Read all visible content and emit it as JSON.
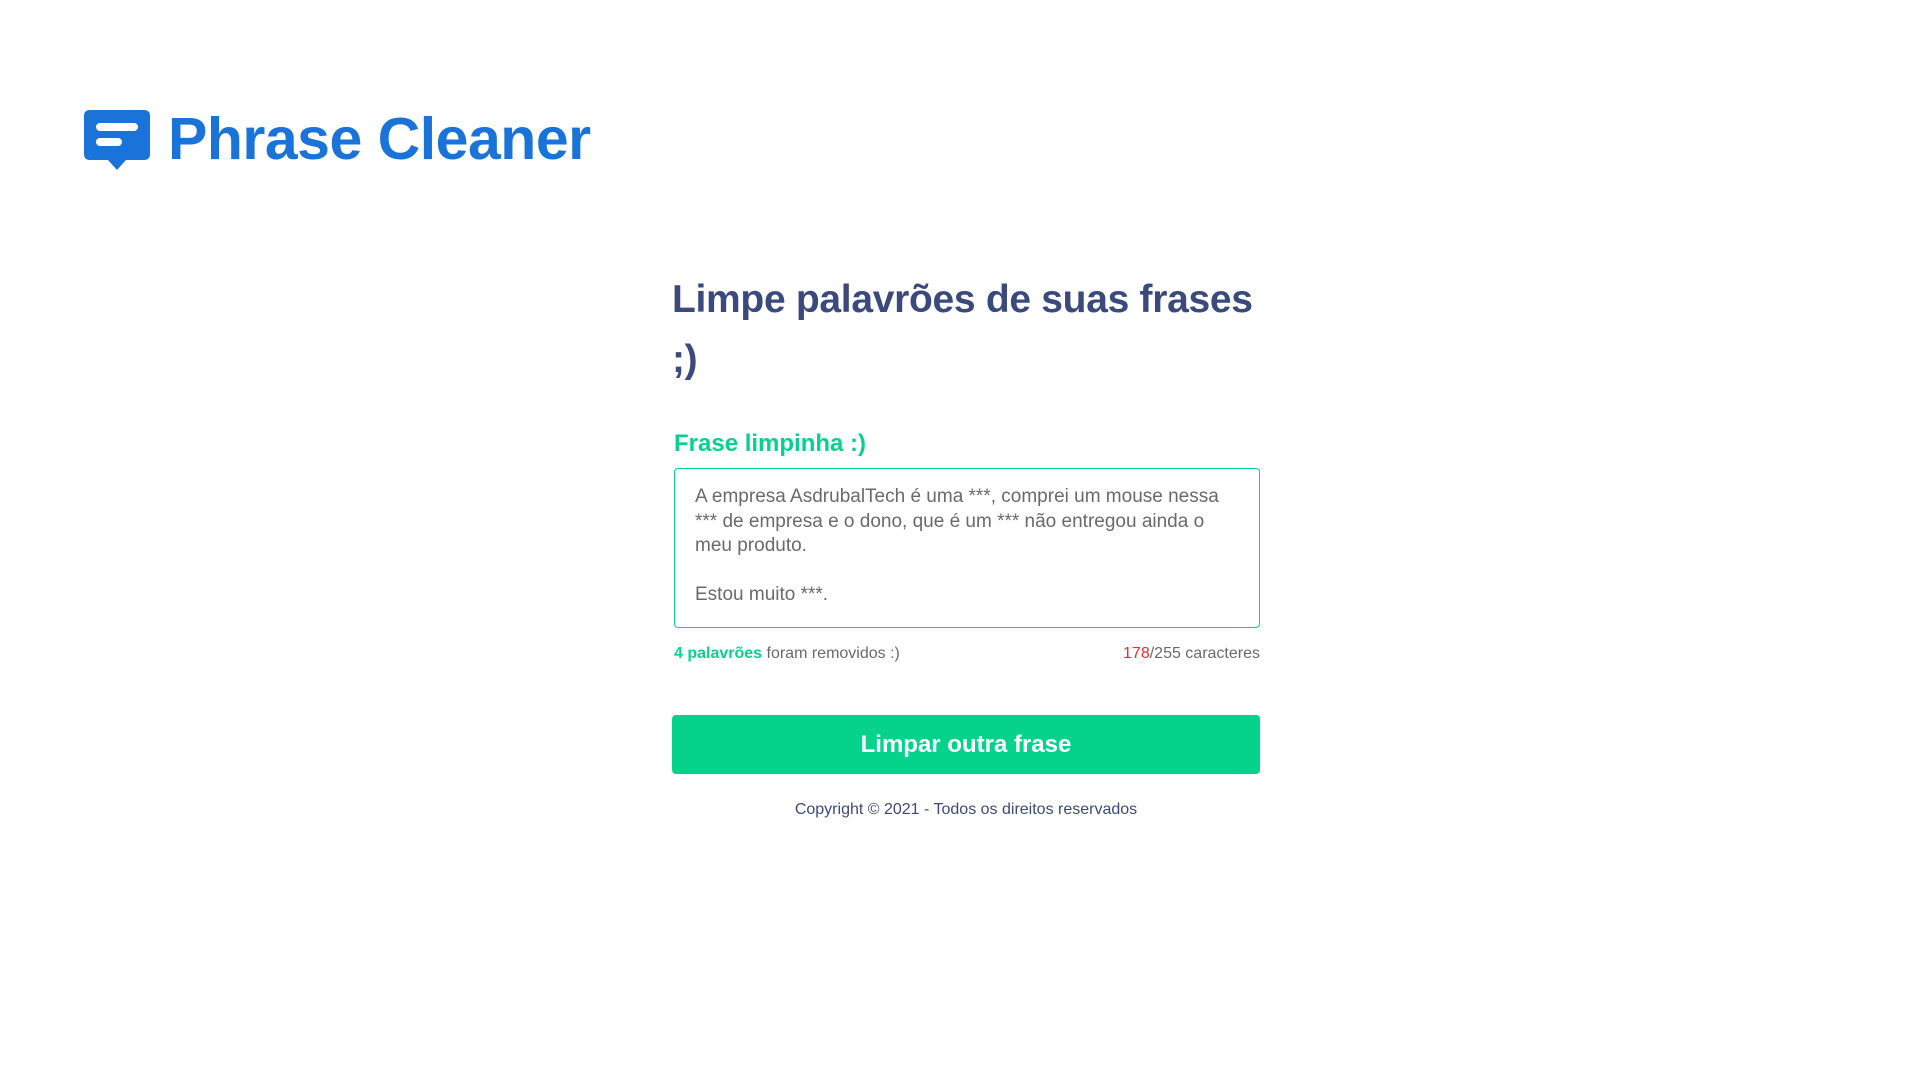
{
  "header": {
    "logo_icon": "chat-message-icon",
    "brand_name": "Phrase Cleaner",
    "brand_color": "#1a73d9"
  },
  "main": {
    "headline": "Limpe palavrões de suas frases ;)",
    "result_label": "Frase limpinha :)",
    "result_text": "A empresa AsdrubalTech é uma ***, comprei um mouse nessa *** de empresa e o dono, que é um *** não entregou ainda o meu produto.\n\nEstou muito ***.",
    "removed_count": "4 palavrões",
    "removed_suffix": " foram removidos :)",
    "char_count": "178",
    "char_limit_suffix": "/255 caracteres",
    "action_label": "Limpar outra frase"
  },
  "footer": {
    "copyright": "Copyright © 2021 - Todos os direitos reservados"
  },
  "colors": {
    "accent": "#05d38c",
    "heading": "#3b4a7c",
    "warning": "#ee2a2a"
  }
}
